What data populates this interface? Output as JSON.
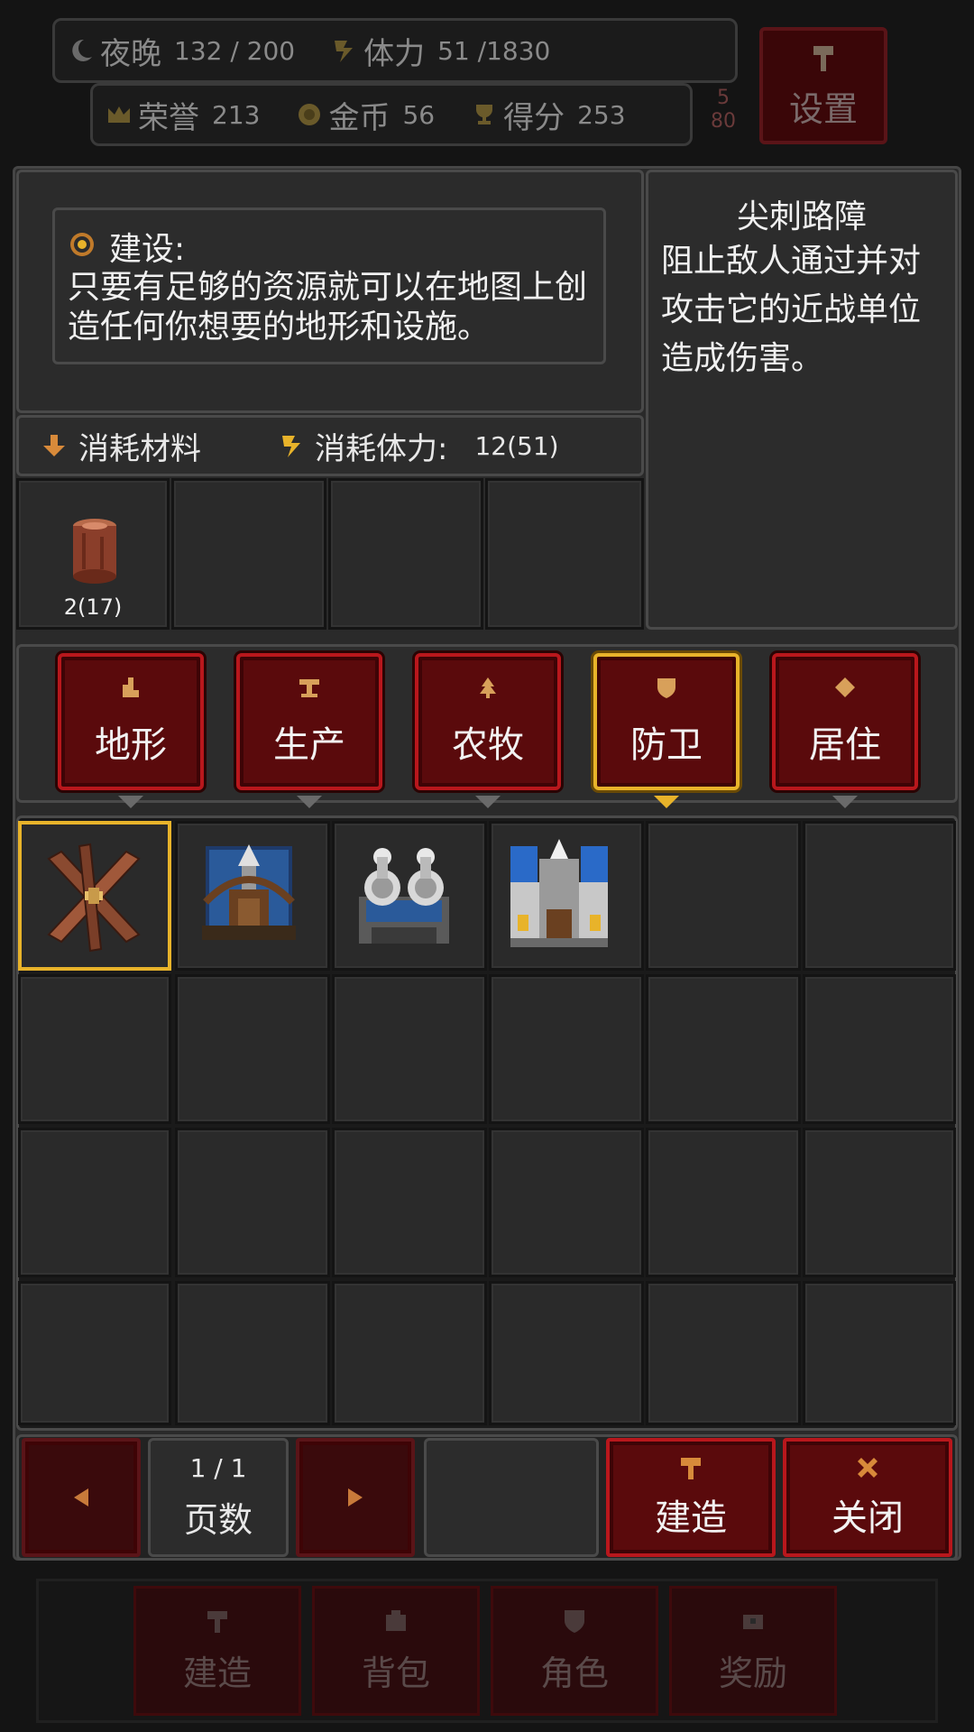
{
  "top_bar": {
    "night_label": "夜晚",
    "night_value": "132 / 200",
    "stamina_label": "体力",
    "stamina_value": "51 /1830",
    "honor_label": "荣誉",
    "honor_value": "213",
    "gold_label": "金币",
    "gold_value": "56",
    "score_label": "得分",
    "score_value": "253",
    "settings_label": "设置",
    "side_num_1": "5",
    "side_num_2": "80"
  },
  "info": {
    "heading": "建设:",
    "description": "只要有足够的资源就可以在地图上创造任何你想要的地形和设施。"
  },
  "item_detail": {
    "name": "尖刺路障",
    "description": "阻止敌人通过并对攻击它的近战单位造成伤害。"
  },
  "cost": {
    "material_label": "消耗材料",
    "stamina_label": "消耗体力:",
    "stamina_value": "12(51)",
    "materials": [
      {
        "icon": "wood-log-icon",
        "amount": "2(17)"
      }
    ]
  },
  "categories": [
    {
      "label": "地形",
      "icon": "terrain-icon"
    },
    {
      "label": "生产",
      "icon": "anvil-icon"
    },
    {
      "label": "农牧",
      "icon": "tree-icon"
    },
    {
      "label": "防卫",
      "icon": "shield-icon",
      "active": true
    },
    {
      "label": "居住",
      "icon": "house-icon"
    }
  ],
  "buildings": [
    {
      "name": "spiked-barricade",
      "icon": "spike-barricade-icon",
      "selected": true
    },
    {
      "name": "ballista-tower",
      "icon": "ballista-icon"
    },
    {
      "name": "twin-cannon-tower",
      "icon": "cannon-tower-icon"
    },
    {
      "name": "fortress",
      "icon": "fortress-icon"
    }
  ],
  "pager": {
    "page_value": "1 / 1",
    "page_label": "页数"
  },
  "actions": {
    "build_label": "建造",
    "close_label": "关闭"
  },
  "bottom_nav": {
    "build": "建造",
    "bag": "背包",
    "role": "角色",
    "reward": "奖励"
  },
  "colors": {
    "accent_red": "#b8171c",
    "selected_gold": "#e8b32a",
    "panel": "#2a2a2a"
  }
}
